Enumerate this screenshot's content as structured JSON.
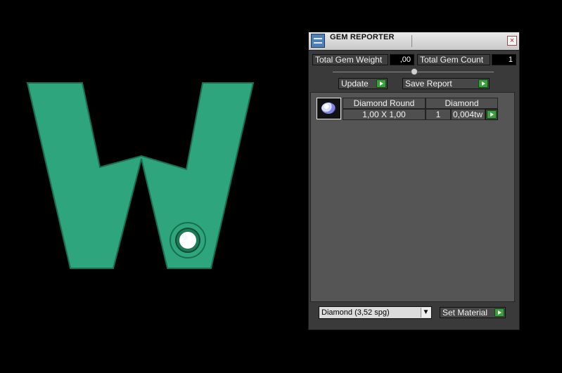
{
  "panel": {
    "title": "GEM REPORTER",
    "close_symbol": "×"
  },
  "summary": {
    "weight_label": "Total Gem Weight",
    "weight_value": ",00",
    "count_label": "Total Gem Count",
    "count_value": "1"
  },
  "actions": {
    "update_label": "Update",
    "save_report_label": "Save Report",
    "set_material_label": "Set Material"
  },
  "gem_row": {
    "shape": "Diamond Round",
    "size": "1,00 X 1,00",
    "material": "Diamond",
    "count": "1",
    "weight": "0,004tw"
  },
  "material_select": {
    "value": "Diamond     (3,52 spg)"
  },
  "colors": {
    "shape_fill": "#2fa57d",
    "shape_dark": "#17704f",
    "panel_bg": "#3a3a3a",
    "list_bg": "#555555",
    "button_green": "#3d9e3f"
  },
  "icons": {
    "title": "gem-reporter-icon",
    "close": "close-icon",
    "row": "round-diamond-icon",
    "play": "play-icon",
    "dropdown": "chevron-down-icon"
  }
}
